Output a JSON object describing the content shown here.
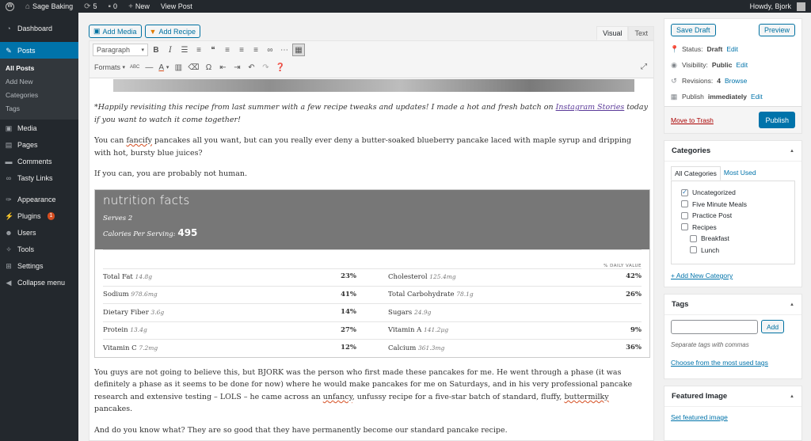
{
  "adminbar": {
    "site_name": "Sage Baking",
    "updates_count": "5",
    "comments_count": "0",
    "new_label": "New",
    "view_post_label": "View Post",
    "howdy": "Howdy, Bjork"
  },
  "sidebar": {
    "dashboard": "Dashboard",
    "posts": "Posts",
    "posts_sub": [
      "All Posts",
      "Add New",
      "Categories",
      "Tags"
    ],
    "media": "Media",
    "pages": "Pages",
    "comments": "Comments",
    "tasty_links": "Tasty Links",
    "appearance": "Appearance",
    "plugins": "Plugins",
    "plugins_badge": "1",
    "users": "Users",
    "tools": "Tools",
    "settings": "Settings",
    "collapse": "Collapse menu"
  },
  "editor": {
    "add_media": "Add Media",
    "add_recipe": "Add Recipe",
    "tab_visual": "Visual",
    "tab_text": "Text",
    "format_select": "Paragraph",
    "formats_label": "Formats",
    "p1_before_link": "*Happily revisiting this recipe from last summer with a few recipe tweaks and updates! I made a hot and fresh batch on ",
    "p1_link": "Instagram Stories",
    "p1_after_link": " today if you want to watch it come together!",
    "p2_before": "You can ",
    "p2_spell": "fancify",
    "p2_after": " pancakes all you want, but can you really ever deny a butter-soaked blueberry pancake laced with maple syrup and dripping with hot, bursty blue juices?",
    "p3": "If you can, you are probably not human.",
    "p4_a": "You guys are not going to believe this, but BJORK was the person who first made these pancakes for me. He went through a phase (it was definitely a phase as it seems to be done for now) where he would make pancakes for me on Saturdays, and in his very professional pancake research and extensive testing – LOLS – he came across an ",
    "p4_spell1": "unfancy",
    "p4_b": ", unfussy recipe for a five-star batch of standard, fluffy, ",
    "p4_spell2": "buttermilky",
    "p4_c": " pancakes.",
    "p5": "And do you know what? They are so good that they have permanently become our standard pancake recipe."
  },
  "nutrition": {
    "title": "nutrition facts",
    "serves": "Serves 2",
    "calories_label": "Calories Per Serving:",
    "calories_value": "495",
    "dv_header": "% DAILY VALUE",
    "rows": [
      {
        "l_name": "Total Fat",
        "l_amt": "14.8g",
        "l_pct": "23%",
        "r_name": "Cholesterol",
        "r_amt": "125.4mg",
        "r_pct": "42%"
      },
      {
        "l_name": "Sodium",
        "l_amt": "978.6mg",
        "l_pct": "41%",
        "r_name": "Total Carbohydrate",
        "r_amt": "78.1g",
        "r_pct": "26%"
      },
      {
        "l_name": "Dietary Fiber",
        "l_amt": "3.6g",
        "l_pct": "14%",
        "r_name": "Sugars",
        "r_amt": "24.9g",
        "r_pct": ""
      },
      {
        "l_name": "Protein",
        "l_amt": "13.4g",
        "l_pct": "27%",
        "r_name": "Vitamin A",
        "r_amt": "141.2µg",
        "r_pct": "9%"
      },
      {
        "l_name": "Vitamin C",
        "l_amt": "7.2mg",
        "l_pct": "12%",
        "r_name": "Calcium",
        "r_amt": "361.3mg",
        "r_pct": "36%"
      }
    ]
  },
  "publish": {
    "save_draft": "Save Draft",
    "preview": "Preview",
    "status_label": "Status:",
    "status_value": "Draft",
    "visibility_label": "Visibility:",
    "visibility_value": "Public",
    "revisions_label": "Revisions:",
    "revisions_value": "4",
    "browse": "Browse",
    "publish_label": "Publish",
    "publish_value": "immediately",
    "edit": "Edit",
    "move_to_trash": "Move to Trash",
    "publish_button": "Publish"
  },
  "categories": {
    "title": "Categories",
    "tab_all": "All Categories",
    "tab_most_used": "Most Used",
    "items": [
      {
        "label": "Uncategorized",
        "checked": true,
        "child": false
      },
      {
        "label": "Five Minute Meals",
        "checked": false,
        "child": false
      },
      {
        "label": "Practice Post",
        "checked": false,
        "child": false
      },
      {
        "label": "Recipes",
        "checked": false,
        "child": false
      },
      {
        "label": "Breakfast",
        "checked": false,
        "child": true
      },
      {
        "label": "Lunch",
        "checked": false,
        "child": true
      }
    ],
    "add_new": "+ Add New Category"
  },
  "tags": {
    "title": "Tags",
    "input_value": "",
    "add_button": "Add",
    "hint": "Separate tags with commas",
    "choose": "Choose from the most used tags"
  },
  "featured": {
    "title": "Featured Image",
    "set_link": "Set featured image"
  }
}
